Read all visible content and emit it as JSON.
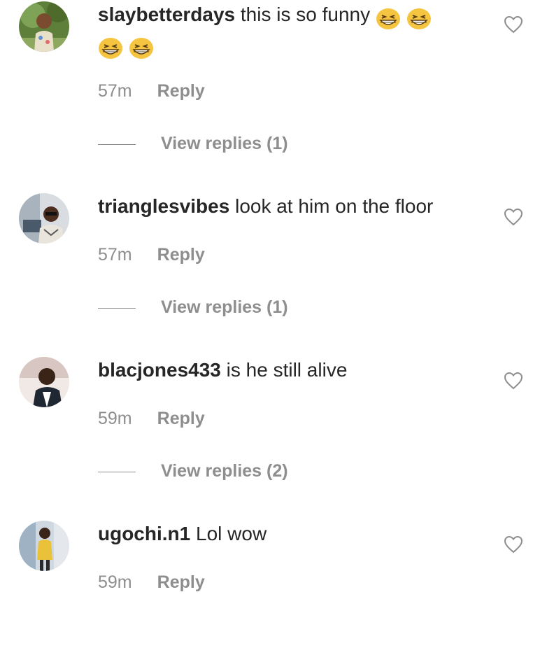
{
  "comments": [
    {
      "username": "slaybetterdays",
      "text": "this is so funny",
      "emoji": "grinning-squinting-face",
      "emoji_count": 4,
      "time": "57m",
      "reply_label": "Reply",
      "view_replies": "View replies (1)",
      "avatar": "avatar-child-photo"
    },
    {
      "username": "trianglesvibes",
      "text": "look at him on the floor",
      "time": "57m",
      "reply_label": "Reply",
      "view_replies": "View replies (1)",
      "avatar": "avatar-man-sunglasses-photo"
    },
    {
      "username": "blacjones433",
      "text": "is he still alive",
      "time": "59m",
      "reply_label": "Reply",
      "view_replies": "View replies (2)",
      "avatar": "avatar-man-photo"
    },
    {
      "username": "ugochi.n1",
      "text": "Lol wow",
      "time": "59m",
      "reply_label": "Reply",
      "avatar": "avatar-woman-photo"
    }
  ],
  "colors": {
    "text": "#262626",
    "secondary": "#8e8e8e",
    "background": "#ffffff"
  },
  "icons": {
    "like": "heart-outline-icon"
  }
}
